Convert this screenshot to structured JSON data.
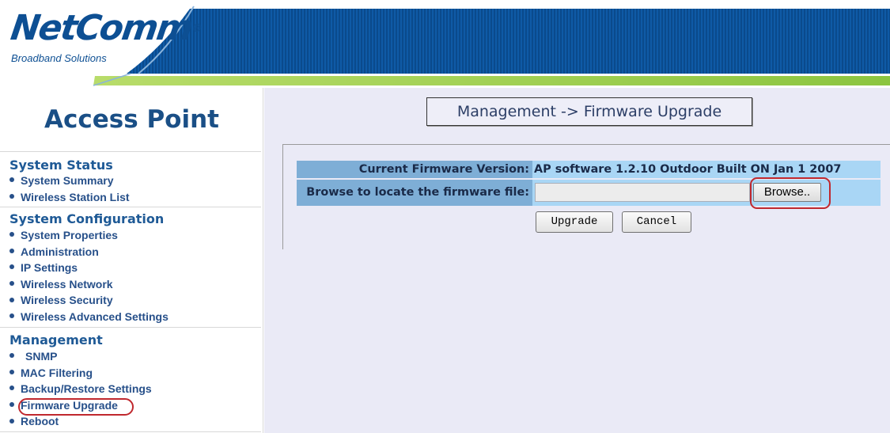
{
  "header": {
    "logo_name": "NetComm",
    "logo_mark": "®",
    "logo_tagline": "Broadband Solutions",
    "colors": {
      "banner_blue": "#0d4f93",
      "accent_green": "#8dc63f"
    }
  },
  "sidebar": {
    "title": "Access Point",
    "sections": [
      {
        "heading": "System Status",
        "items": [
          "System Summary",
          "Wireless Station List"
        ]
      },
      {
        "heading": "System Configuration",
        "items": [
          "System Properties",
          "Administration",
          "IP Settings",
          "Wireless Network",
          "Wireless Security",
          "Wireless Advanced Settings"
        ]
      },
      {
        "heading": "Management",
        "items": [
          "SNMP",
          "MAC Filtering",
          "Backup/Restore Settings",
          "Firmware Upgrade",
          "Reboot"
        ]
      }
    ],
    "highlighted_item": "Firmware Upgrade"
  },
  "main": {
    "page_title": "Management -> Firmware Upgrade",
    "firmware_label": "Current Firmware Version:",
    "firmware_value": "AP software 1.2.10 Outdoor Built ON Jan 1 2007",
    "browse_label": "Browse to locate the firmware file:",
    "file_input_value": "",
    "browse_button": "Browse..",
    "upgrade_button": "Upgrade",
    "cancel_button": "Cancel"
  },
  "colors": {
    "label_cell": "#7eaed6",
    "value_cell": "#a9d6f5",
    "main_background": "#eaeaf6",
    "highlight_ring": "#c0282e"
  }
}
